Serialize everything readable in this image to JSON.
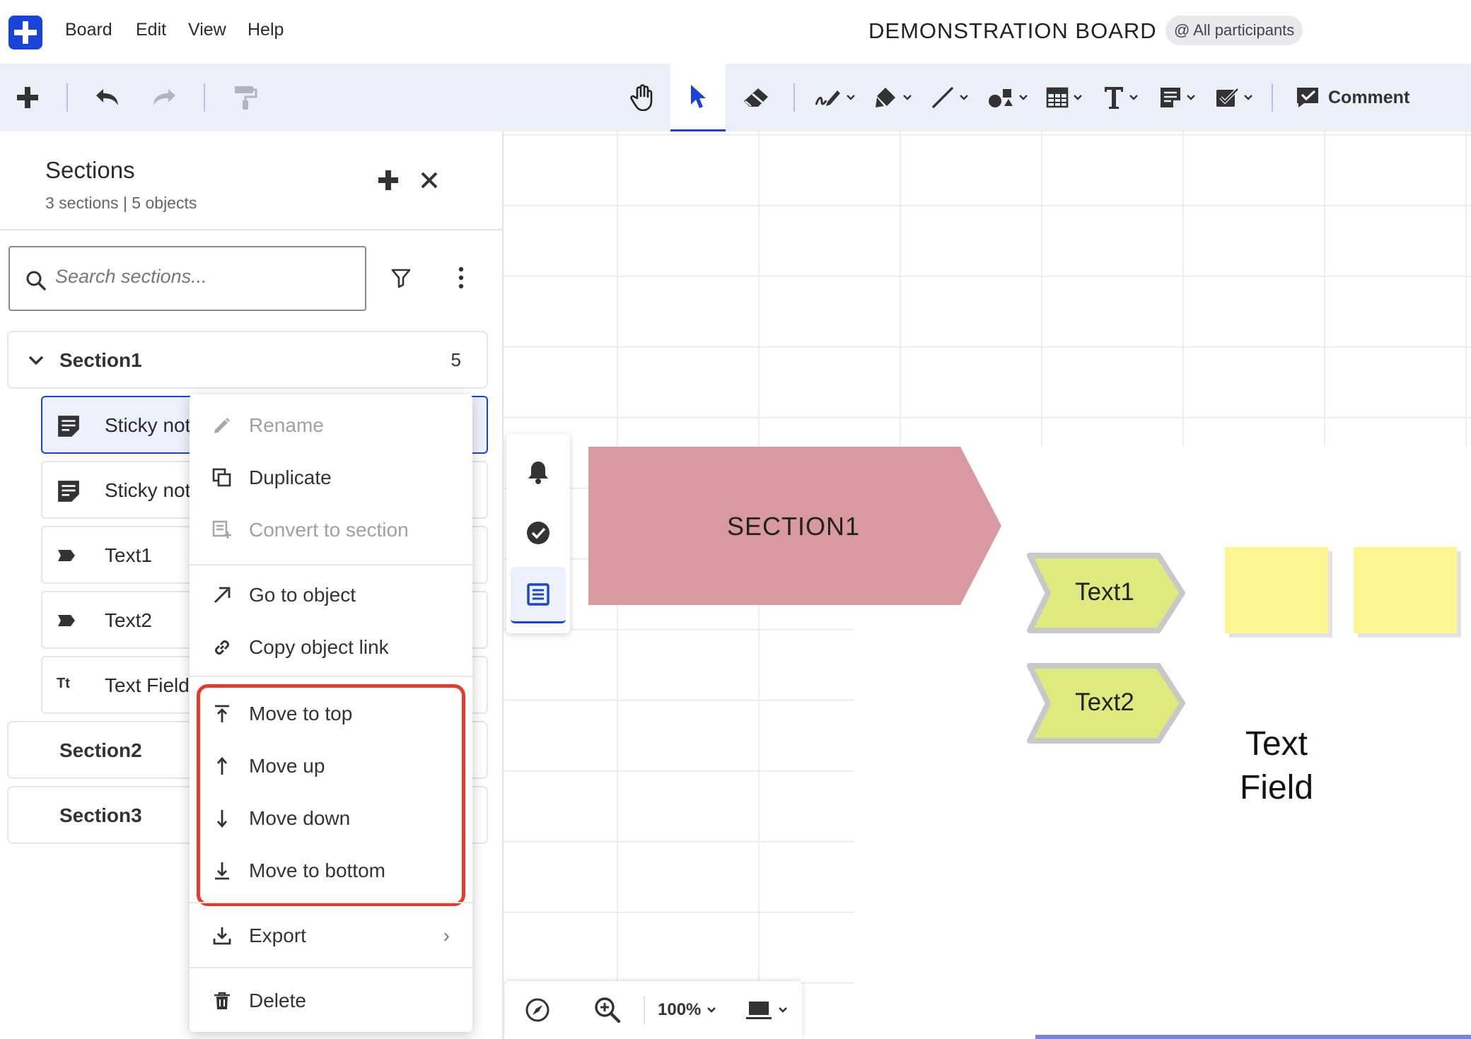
{
  "menubar": {
    "menus": [
      "Board",
      "Edit",
      "View",
      "Help"
    ],
    "board_title": "DEMONSTRATION BOARD",
    "participants": "@ All participants"
  },
  "toolbar": {
    "comment_label": "Comment",
    "active_tool": "select"
  },
  "sidebar": {
    "title": "Sections",
    "subtitle": "3 sections | 5 objects",
    "search_placeholder": "Search sections...",
    "sections": [
      {
        "name": "Section1",
        "count": "5",
        "expanded": true,
        "objects": [
          {
            "name": "Sticky note",
            "icon": "sticky-note-icon",
            "active": true
          },
          {
            "name": "Sticky note",
            "icon": "sticky-note-icon",
            "active": false
          },
          {
            "name": "Text1",
            "icon": "label-icon",
            "active": false
          },
          {
            "name": "Text2",
            "icon": "label-icon",
            "active": false
          },
          {
            "name": "Text Field",
            "icon": "text-type-icon",
            "active": false
          }
        ]
      },
      {
        "name": "Section2"
      },
      {
        "name": "Section3"
      }
    ]
  },
  "context_menu": {
    "items": [
      {
        "label": "Rename",
        "icon": "pencil-icon",
        "disabled": true
      },
      {
        "label": "Duplicate",
        "icon": "duplicate-icon",
        "disabled": false
      },
      {
        "label": "Convert to section",
        "icon": "convert-section-icon",
        "disabled": true
      },
      {
        "label": "Go to object",
        "icon": "arrow-up-right-icon",
        "disabled": false
      },
      {
        "label": "Copy object link",
        "icon": "link-icon",
        "disabled": false
      },
      {
        "label": "Move to top",
        "icon": "move-to-top-icon",
        "disabled": false
      },
      {
        "label": "Move up",
        "icon": "arrow-up-icon",
        "disabled": false
      },
      {
        "label": "Move down",
        "icon": "arrow-down-icon",
        "disabled": false
      },
      {
        "label": "Move to bottom",
        "icon": "move-to-bottom-icon",
        "disabled": false
      },
      {
        "label": "Export",
        "icon": "download-icon",
        "disabled": false
      },
      {
        "label": "Delete",
        "icon": "trash-icon",
        "disabled": false
      }
    ],
    "export_chevron": "›",
    "highlight_color": "#e63a2b"
  },
  "canvas": {
    "section_label": "SECTION1",
    "chevrons": [
      "Text1",
      "Text2"
    ],
    "text_field": [
      "Text",
      "Field"
    ],
    "colors": {
      "section_tag": "#d89aa0",
      "chevron_fill": "#dfea7e",
      "chevron_border": "#c8c8c8",
      "sticky": "#fdf594"
    }
  },
  "bottombar": {
    "zoom": "100%"
  },
  "colors": {
    "accent": "#1a43d9",
    "toolbar_bg": "#eceef8"
  }
}
